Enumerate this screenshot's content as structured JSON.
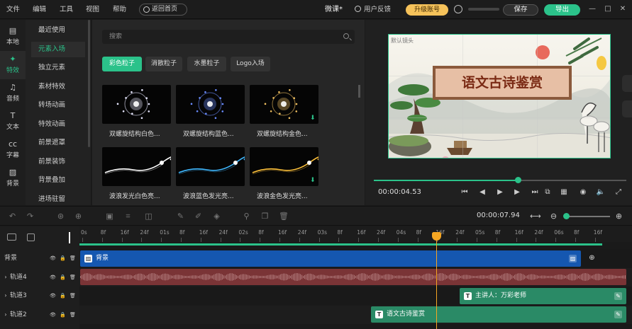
{
  "menu": {
    "file": "文件",
    "edit": "编辑",
    "tools": "工具",
    "view": "视图",
    "help": "帮助"
  },
  "topbar": {
    "home_button": "返回首页",
    "project_title": "微课*",
    "feedback": "用户反馈",
    "upgrade": "升级账号",
    "save": "保存",
    "export": "导出",
    "window_controls": [
      "minimize-icon",
      "maximize-icon",
      "close-icon"
    ]
  },
  "left_nav": [
    {
      "label": "本地",
      "icon": "folder-icon",
      "active": false
    },
    {
      "label": "特效",
      "icon": "sparkle-icon",
      "active": true
    },
    {
      "label": "音频",
      "icon": "music-icon",
      "active": false
    },
    {
      "label": "文本",
      "icon": "text-icon",
      "active": false
    },
    {
      "label": "字幕",
      "icon": "caption-icon",
      "active": false
    },
    {
      "label": "背景",
      "icon": "image-icon",
      "active": false
    }
  ],
  "categories": [
    {
      "label": "最近使用",
      "active": false
    },
    {
      "label": "元素入场",
      "active": true
    },
    {
      "label": "独立元素",
      "active": false
    },
    {
      "label": "素材特效",
      "active": false
    },
    {
      "label": "转场动画",
      "active": false
    },
    {
      "label": "特效动画",
      "active": false
    },
    {
      "label": "前景遮罩",
      "active": false
    },
    {
      "label": "前景装饰",
      "active": false
    },
    {
      "label": "背景叠加",
      "active": false
    },
    {
      "label": "进场驻留",
      "active": false
    }
  ],
  "search": {
    "placeholder": "搜索"
  },
  "subtabs": [
    {
      "label": "彩色粒子",
      "active": true
    },
    {
      "label": "消散粒子",
      "active": false
    },
    {
      "label": "水墨粒子",
      "active": false
    },
    {
      "label": "Logo入场",
      "active": false
    }
  ],
  "effects": [
    {
      "label": "双螺旋结构白色...",
      "color": "#e8e8ff",
      "style": "burst",
      "download": false
    },
    {
      "label": "双螺旋结构蓝色...",
      "color": "#6a8cff",
      "style": "burst",
      "download": false
    },
    {
      "label": "双螺旋结构金色...",
      "color": "#f0c060",
      "style": "burst",
      "download": true
    },
    {
      "label": "波浪发光白色亮...",
      "color": "#ffffff",
      "style": "wave",
      "download": false
    },
    {
      "label": "波浪蓝色发光亮...",
      "color": "#3fb8ff",
      "style": "wave",
      "download": false
    },
    {
      "label": "波浪金色发光亮...",
      "color": "#ffc23a",
      "style": "wave",
      "download": true
    }
  ],
  "preview": {
    "camera_label": "默认镜头",
    "title": "语文古诗鉴赏",
    "current_time": "00:00:04.53",
    "progress": 0.57
  },
  "preview_controls": [
    "prev-frame-icon",
    "step-back-icon",
    "play-icon",
    "step-forward-icon",
    "next-frame-icon",
    "screen-record-icon",
    "grid-icon",
    "snapshot-icon",
    "volume-icon",
    "fullscreen-icon"
  ],
  "timeline": {
    "total_time": "00:00:07.94",
    "ruler_labels": [
      "0s",
      "8f",
      "16f",
      "24f",
      "01s",
      "8f",
      "16f",
      "24f",
      "02s",
      "8f",
      "16f",
      "24f",
      "03s",
      "8f",
      "16f",
      "24f",
      "04s",
      "8f",
      "16f",
      "24f",
      "05s",
      "8f",
      "16f",
      "24f",
      "06s",
      "8f",
      "16f"
    ],
    "playhead_time": "04s 16f",
    "tracks": [
      {
        "name": "背景",
        "clip": "背景",
        "color": "#1557b0"
      },
      {
        "name": "轨道4",
        "clip": "",
        "color": "#7a3436"
      },
      {
        "name": "轨道3",
        "clip": "主讲人：万彩老师",
        "color": "#2a8a66"
      },
      {
        "name": "轨道2",
        "clip": "语文古诗鉴赏",
        "color": "#2a8a66"
      }
    ]
  }
}
